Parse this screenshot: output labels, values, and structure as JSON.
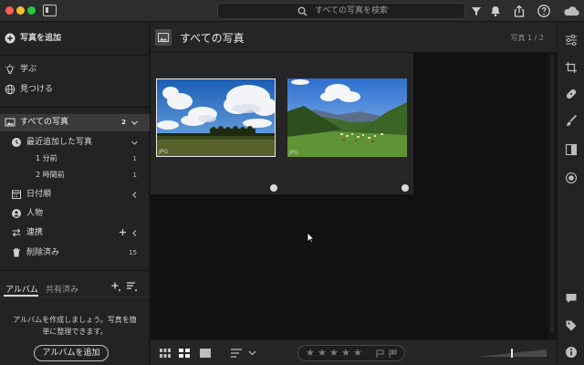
{
  "titlebar": {
    "search_placeholder": "すべての写真を検索",
    "icons": [
      "panel-toggle-icon",
      "search-icon",
      "filter-icon",
      "notification-bell-icon",
      "share-icon",
      "help-icon",
      "cloud-icon"
    ]
  },
  "left_panel": {
    "add_photos": "写真を追加",
    "learn": "学ぶ",
    "discover": "見つける",
    "all_photos": {
      "label": "すべての写真",
      "count": "2"
    },
    "recently_added": {
      "label": "最近追加した写真"
    },
    "recent_items": [
      {
        "label": "1 分前",
        "count": "1"
      },
      {
        "label": "2 時間前",
        "count": "1"
      }
    ],
    "by_date": "日付順",
    "people": "人物",
    "connections": "連携",
    "deleted": {
      "label": "削除済み",
      "count": "15"
    },
    "tabs": {
      "albums": "アルバム",
      "shared": "共有済み"
    },
    "album_message": "アルバムを作成しましょう。写真を簡単に整理できます。",
    "add_album_button": "アルバムを追加"
  },
  "main": {
    "title": "すべての写真",
    "count": "写真 1 / 2",
    "photos": [
      {
        "format": "JPG",
        "subject": "blue sky with clouds over a green field",
        "selected": true
      },
      {
        "format": "JPG",
        "subject": "mountain valley village",
        "selected": false
      }
    ]
  },
  "bottombar": {
    "stars": [
      "★",
      "★",
      "★",
      "★",
      "★"
    ]
  },
  "colors": {
    "background": "#111111",
    "panel": "#232323",
    "selection": "#3a3a3a"
  }
}
